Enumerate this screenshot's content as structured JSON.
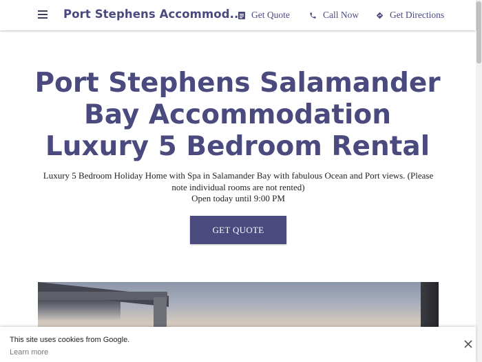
{
  "header": {
    "title": "Port Stephens Accommod...",
    "nav": {
      "quote_label": "Get Quote",
      "call_label": "Call Now",
      "directions_label": "Get Directions"
    }
  },
  "hero": {
    "title": "Port Stephens Salamander Bay Accommodation Luxury 5 Bedroom Rental",
    "tagline": "Luxury 5 Bedroom Holiday Home with Spa in Salamander Bay with fabulous Ocean and Port views. (Please note individual rooms are not rented)",
    "hours": "Open today until 9:00 PM",
    "cta_label": "GET QUOTE"
  },
  "cookie_notice": {
    "text": "This site uses cookies from Google.",
    "link_label": "Learn more"
  },
  "icons": {
    "menu": "menu-icon",
    "quote": "form-icon",
    "call": "phone-icon",
    "directions": "directions-icon",
    "close": "close-icon"
  },
  "colors": {
    "accent": "#4a4a7f",
    "text": "#222222",
    "background": "#ffffff"
  }
}
